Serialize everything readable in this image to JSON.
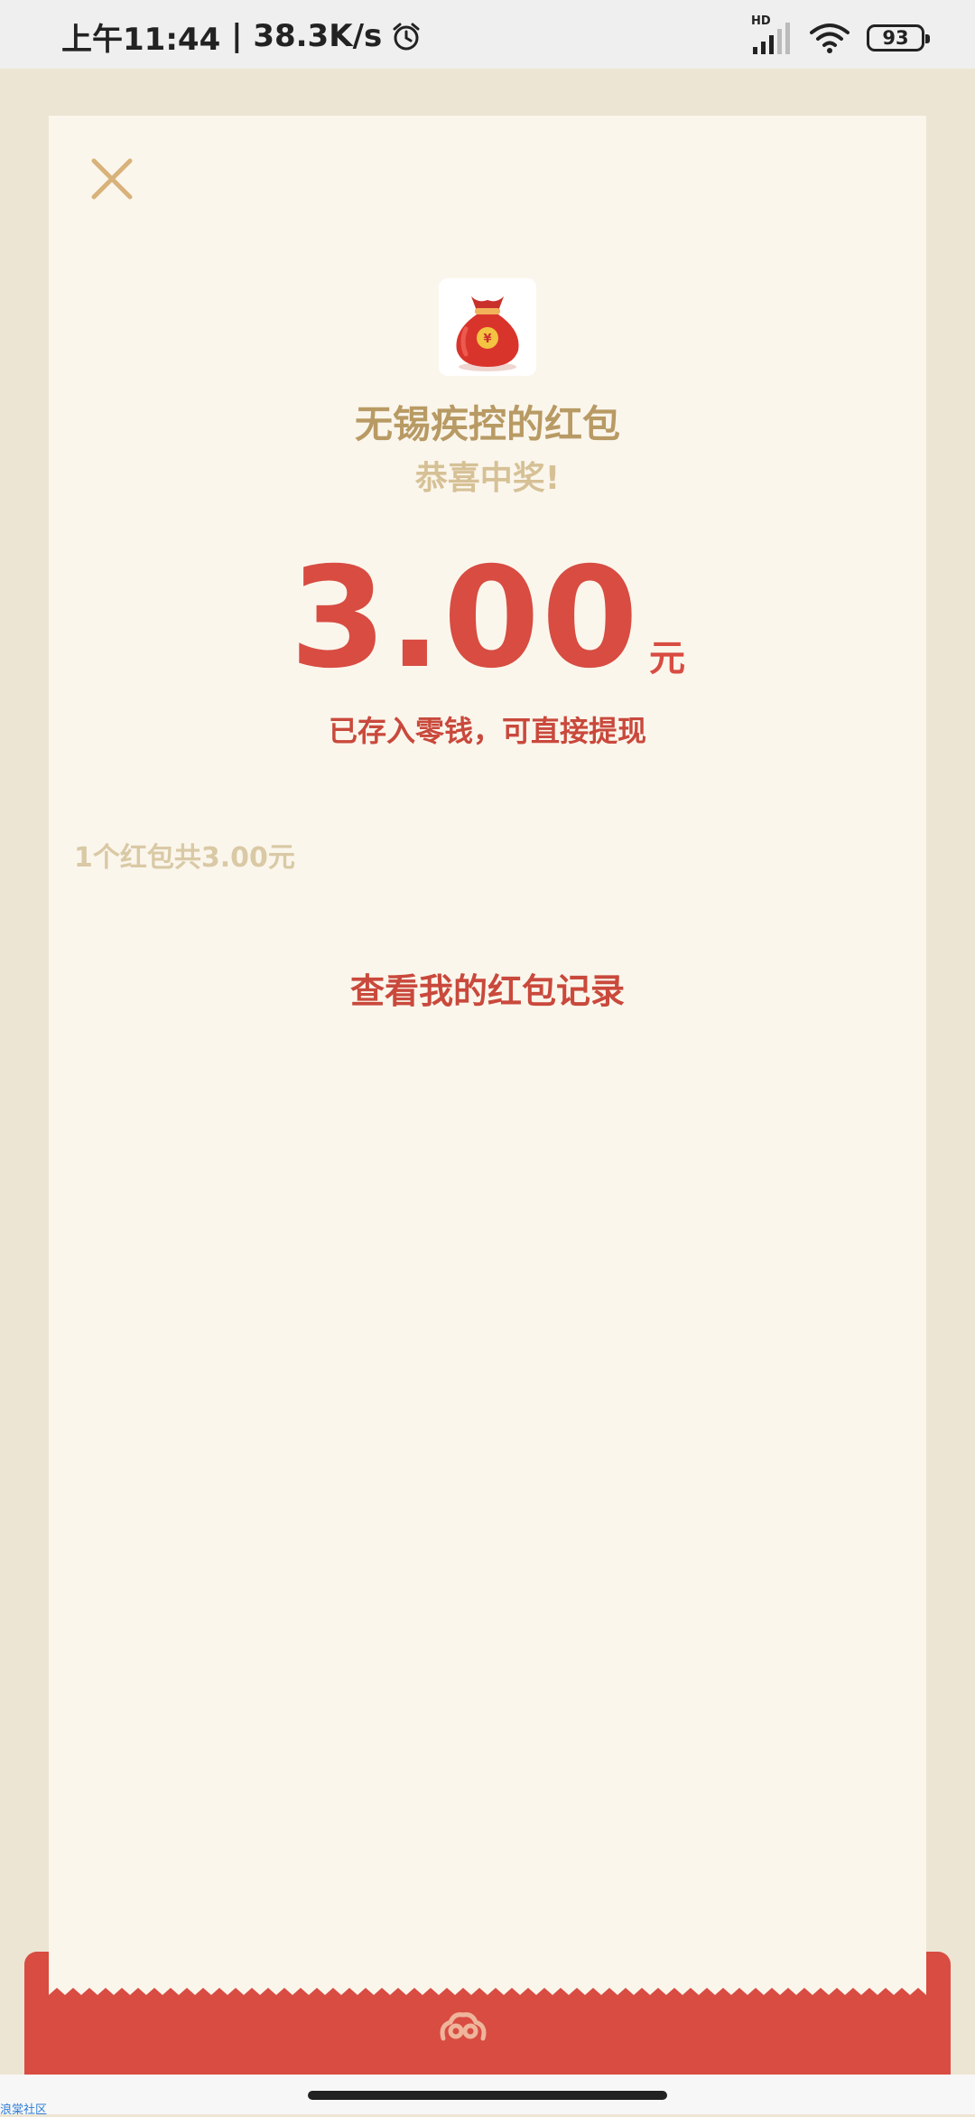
{
  "status_bar": {
    "time": "上午11:44",
    "speed": "38.3K/s",
    "battery": "93",
    "network_label": "HD"
  },
  "packet": {
    "sender": "无锡疾控的红包",
    "greeting": "恭喜中奖!",
    "amount": "3.00",
    "unit": "元",
    "saved_note": "已存入零钱，可直接提现",
    "summary": "1个红包共3.00元",
    "records_link": "查看我的红包记录"
  },
  "watermark": "浪棠社区",
  "colors": {
    "accent": "#d84c42",
    "gold": "#b89a64",
    "card_bg": "#fbf6ec",
    "page_bg": "#ede5d3"
  },
  "icons": {
    "close": "close-icon",
    "alarm": "alarm-icon",
    "signal": "signal-icon",
    "wifi": "wifi-icon",
    "battery": "battery-icon",
    "avatar": "money-bag-icon",
    "decor": "cloud-icon"
  }
}
